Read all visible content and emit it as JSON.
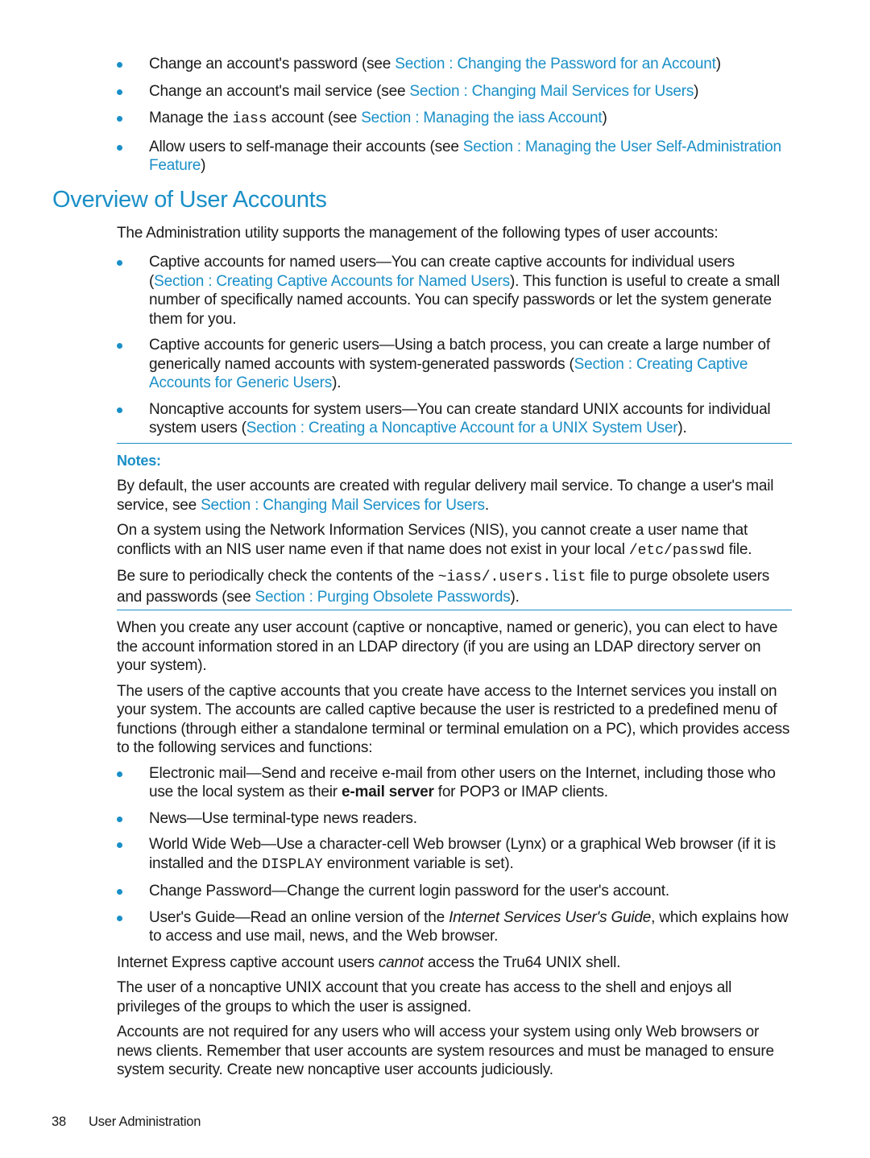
{
  "top_list": [
    {
      "text": "Change an account's password (see ",
      "link": "Section : Changing the Password for an Account",
      "after": ")"
    },
    {
      "text": "Change an account's mail service (see ",
      "link": "Section : Changing Mail Services for Users",
      "after": ")"
    },
    {
      "text_pre": "Manage the ",
      "code": "iass",
      "text": " account (see ",
      "link": "Section : Managing the iass Account",
      "after": ")"
    },
    {
      "text": "Allow users to self-manage their accounts (see ",
      "link": "Section : Managing the User Self-Administration Feature",
      "after": ")"
    }
  ],
  "section_title": "Overview of User Accounts",
  "intro": "The Administration utility supports the management of the following types of user accounts:",
  "account_types": [
    {
      "lead": "Captive accounts for named users—You can create captive accounts for individual users (",
      "link": "Section : Creating Captive Accounts for Named Users",
      "after": "). This function is useful to create a small number of specifically named accounts. You can specify passwords or let the system generate them for you."
    },
    {
      "lead": "Captive accounts for generic users—Using a batch process, you can create a large number of generically named accounts with system-generated passwords (",
      "link": "Section : Creating Captive Accounts for Generic Users",
      "after": ")."
    },
    {
      "lead": "Noncaptive accounts for system users—You can create standard UNIX accounts for individual system users (",
      "link": "Section : Creating a Noncaptive Account for a UNIX System User",
      "after": ")."
    }
  ],
  "notes": {
    "title": "Notes:",
    "p1_text": "By default, the user accounts are created with regular delivery mail service. To change a user's mail service, see ",
    "p1_link": "Section : Changing Mail Services for Users",
    "p1_after": ".",
    "p2_text": "On a system using the Network Information Services (NIS), you cannot create a user name that conflicts with an NIS user name even if that name does not exist in your local ",
    "p2_code": "/etc/passwd",
    "p2_after": " file.",
    "p3_text": "Be sure to periodically check the contents of the ",
    "p3_code": "~iass/.users.list",
    "p3_mid": " file to purge obsolete users and passwords (see ",
    "p3_link": "Section : Purging Obsolete Passwords",
    "p3_after": ")."
  },
  "body": {
    "p1": "When you create any user account (captive or noncaptive, named or generic), you can elect to have the account information stored in an LDAP directory (if you are using an LDAP directory server on your system).",
    "p2": "The users of the captive accounts that you create have access to the Internet services you install on your system. The accounts are called captive because the user is restricted to a predefined menu of functions (through either a standalone terminal or terminal emulation on a PC), which provides access to the following services and functions:",
    "services": {
      "email_pre": "Electronic mail—Send and receive e-mail from other users on the Internet, including those who use the local system as their ",
      "email_bold": "e-mail server",
      "email_after": " for POP3 or IMAP clients.",
      "news": "News—Use terminal-type news readers.",
      "www_pre": "World Wide Web—Use a character-cell Web browser (Lynx) or a graphical Web browser (if it is installed and the ",
      "www_code": "DISPLAY",
      "www_after": " environment variable is set).",
      "passwd": "Change Password—Change the current login password for the user's account.",
      "guide_pre": "User's Guide—Read an online version of the ",
      "guide_italic": "Internet Services User's Guide",
      "guide_after": ", which explains how to access and use mail, news, and the Web browser."
    },
    "p3_pre": "Internet Express captive account users ",
    "p3_italic": "cannot",
    "p3_after": " access the Tru64 UNIX shell.",
    "p4": "The user of a noncaptive UNIX account that you create has access to the shell and enjoys all privileges of the groups to which the user is assigned.",
    "p5": "Accounts are not required for any users who will access your system using only Web browsers or news clients. Remember that user accounts are system resources and must be managed to ensure system security. Create new noncaptive user accounts judiciously."
  },
  "footer": {
    "page_number": "38",
    "chapter": "User Administration"
  },
  "colors": {
    "accent": "#1a8fc7",
    "text": "#1a1a1a"
  }
}
